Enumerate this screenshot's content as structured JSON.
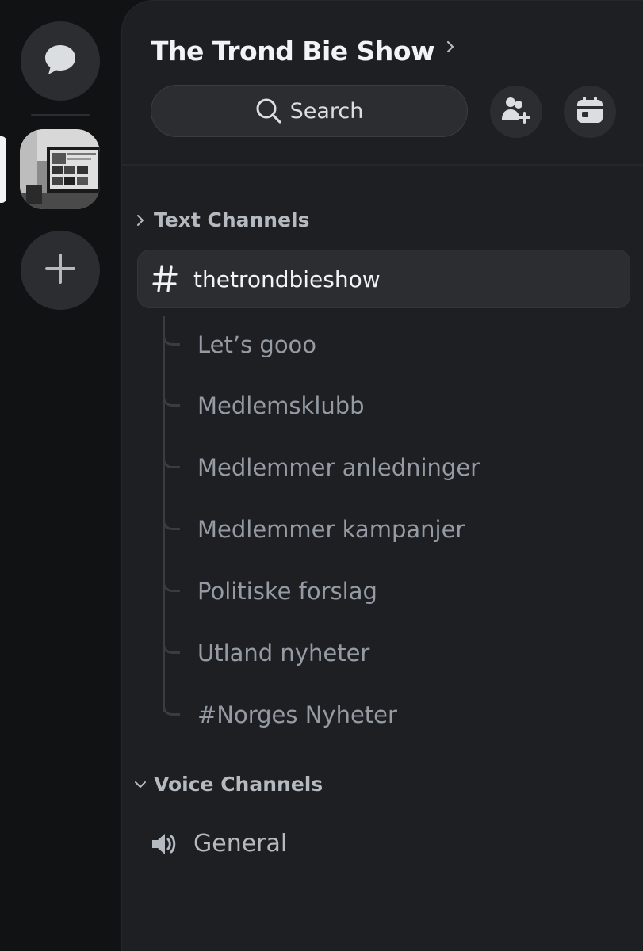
{
  "server": {
    "name": "The Trond Bie Show"
  },
  "search": {
    "label": "Search"
  },
  "categories": {
    "text": {
      "label": "Text Channels"
    },
    "voice": {
      "label": "Voice Channels"
    }
  },
  "active_channel": {
    "name": "thetrondbieshow"
  },
  "threads": [
    {
      "label": "Let’s gooo"
    },
    {
      "label": "Medlemsklubb"
    },
    {
      "label": "Medlemmer anledninger"
    },
    {
      "label": "Medlemmer kampanjer"
    },
    {
      "label": "Politiske forslag"
    },
    {
      "label": "Utland nyheter"
    },
    {
      "label": "#Norges Nyheter"
    }
  ],
  "voice_channels": [
    {
      "name": "General"
    }
  ],
  "icons": {
    "dm": "chat-bubble-icon",
    "add_server": "plus-icon",
    "title_chevron": "chevron-right-icon",
    "search": "search-icon",
    "invite": "add-member-icon",
    "events": "calendar-icon",
    "text_category": "chevron-right-icon",
    "voice_category": "chevron-down-icon",
    "channel": "hash-icon",
    "voice": "speaker-icon"
  },
  "colors": {
    "rail_background": "#111214",
    "panel_background": "#1e1f22",
    "button_background": "#2b2d31",
    "text_primary": "#f2f3f5",
    "text_muted": "#949ba4",
    "text_secondary": "#b5bac1"
  }
}
